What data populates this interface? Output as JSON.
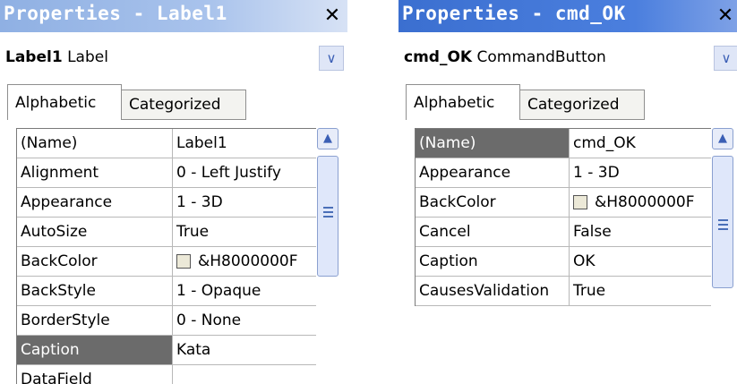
{
  "colors": {
    "titlebar_left": "#8fb0e3",
    "titlebar_right": "#3b6fd0",
    "selected_row": "#6b6b6b"
  },
  "left": {
    "title": "Properties - Label1",
    "object_bold": "Label1",
    "object_type": "Label",
    "tabs": [
      "Alphabetic",
      "Categorized"
    ],
    "rows": [
      {
        "name": "(Name)",
        "value": "Label1"
      },
      {
        "name": "Alignment",
        "value": "0 - Left Justify"
      },
      {
        "name": "Appearance",
        "value": "1 - 3D"
      },
      {
        "name": "AutoSize",
        "value": "True"
      },
      {
        "name": "BackColor",
        "value": "&H8000000F"
      },
      {
        "name": "BackStyle",
        "value": "1 - Opaque"
      },
      {
        "name": "BorderStyle",
        "value": "0 - None"
      },
      {
        "name": "Caption",
        "value": "Kata"
      },
      {
        "name": "DataField",
        "value": ""
      }
    ]
  },
  "right": {
    "title": "Properties - cmd_OK",
    "object_bold": "cmd_OK",
    "object_type": "CommandButton",
    "tabs": [
      "Alphabetic",
      "Categorized"
    ],
    "rows": [
      {
        "name": "(Name)",
        "value": "cmd_OK"
      },
      {
        "name": "Appearance",
        "value": "1 - 3D"
      },
      {
        "name": "BackColor",
        "value": "&H8000000F"
      },
      {
        "name": "Cancel",
        "value": "False"
      },
      {
        "name": "Caption",
        "value": "OK"
      },
      {
        "name": "CausesValidation",
        "value": "True"
      }
    ]
  },
  "icons": {
    "close": "×-close-icon",
    "dropdown": "chevron-down-icon",
    "scroll_up": "caret-up-icon",
    "grip": "scroll-grip-icon",
    "color": "color-swatch-icon"
  }
}
